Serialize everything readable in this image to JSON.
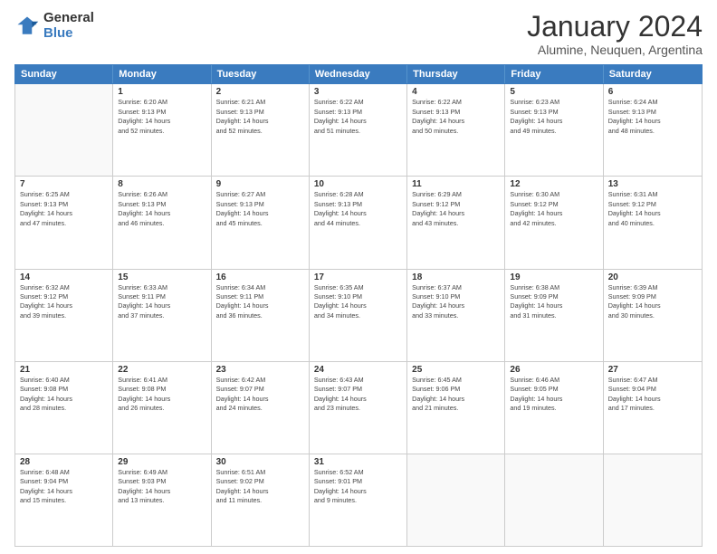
{
  "logo": {
    "text_general": "General",
    "text_blue": "Blue"
  },
  "title": "January 2024",
  "subtitle": "Alumine, Neuquen, Argentina",
  "header_days": [
    "Sunday",
    "Monday",
    "Tuesday",
    "Wednesday",
    "Thursday",
    "Friday",
    "Saturday"
  ],
  "weeks": [
    [
      {
        "day": "",
        "info": ""
      },
      {
        "day": "1",
        "info": "Sunrise: 6:20 AM\nSunset: 9:13 PM\nDaylight: 14 hours\nand 52 minutes."
      },
      {
        "day": "2",
        "info": "Sunrise: 6:21 AM\nSunset: 9:13 PM\nDaylight: 14 hours\nand 52 minutes."
      },
      {
        "day": "3",
        "info": "Sunrise: 6:22 AM\nSunset: 9:13 PM\nDaylight: 14 hours\nand 51 minutes."
      },
      {
        "day": "4",
        "info": "Sunrise: 6:22 AM\nSunset: 9:13 PM\nDaylight: 14 hours\nand 50 minutes."
      },
      {
        "day": "5",
        "info": "Sunrise: 6:23 AM\nSunset: 9:13 PM\nDaylight: 14 hours\nand 49 minutes."
      },
      {
        "day": "6",
        "info": "Sunrise: 6:24 AM\nSunset: 9:13 PM\nDaylight: 14 hours\nand 48 minutes."
      }
    ],
    [
      {
        "day": "7",
        "info": "Sunrise: 6:25 AM\nSunset: 9:13 PM\nDaylight: 14 hours\nand 47 minutes."
      },
      {
        "day": "8",
        "info": "Sunrise: 6:26 AM\nSunset: 9:13 PM\nDaylight: 14 hours\nand 46 minutes."
      },
      {
        "day": "9",
        "info": "Sunrise: 6:27 AM\nSunset: 9:13 PM\nDaylight: 14 hours\nand 45 minutes."
      },
      {
        "day": "10",
        "info": "Sunrise: 6:28 AM\nSunset: 9:13 PM\nDaylight: 14 hours\nand 44 minutes."
      },
      {
        "day": "11",
        "info": "Sunrise: 6:29 AM\nSunset: 9:12 PM\nDaylight: 14 hours\nand 43 minutes."
      },
      {
        "day": "12",
        "info": "Sunrise: 6:30 AM\nSunset: 9:12 PM\nDaylight: 14 hours\nand 42 minutes."
      },
      {
        "day": "13",
        "info": "Sunrise: 6:31 AM\nSunset: 9:12 PM\nDaylight: 14 hours\nand 40 minutes."
      }
    ],
    [
      {
        "day": "14",
        "info": "Sunrise: 6:32 AM\nSunset: 9:12 PM\nDaylight: 14 hours\nand 39 minutes."
      },
      {
        "day": "15",
        "info": "Sunrise: 6:33 AM\nSunset: 9:11 PM\nDaylight: 14 hours\nand 37 minutes."
      },
      {
        "day": "16",
        "info": "Sunrise: 6:34 AM\nSunset: 9:11 PM\nDaylight: 14 hours\nand 36 minutes."
      },
      {
        "day": "17",
        "info": "Sunrise: 6:35 AM\nSunset: 9:10 PM\nDaylight: 14 hours\nand 34 minutes."
      },
      {
        "day": "18",
        "info": "Sunrise: 6:37 AM\nSunset: 9:10 PM\nDaylight: 14 hours\nand 33 minutes."
      },
      {
        "day": "19",
        "info": "Sunrise: 6:38 AM\nSunset: 9:09 PM\nDaylight: 14 hours\nand 31 minutes."
      },
      {
        "day": "20",
        "info": "Sunrise: 6:39 AM\nSunset: 9:09 PM\nDaylight: 14 hours\nand 30 minutes."
      }
    ],
    [
      {
        "day": "21",
        "info": "Sunrise: 6:40 AM\nSunset: 9:08 PM\nDaylight: 14 hours\nand 28 minutes."
      },
      {
        "day": "22",
        "info": "Sunrise: 6:41 AM\nSunset: 9:08 PM\nDaylight: 14 hours\nand 26 minutes."
      },
      {
        "day": "23",
        "info": "Sunrise: 6:42 AM\nSunset: 9:07 PM\nDaylight: 14 hours\nand 24 minutes."
      },
      {
        "day": "24",
        "info": "Sunrise: 6:43 AM\nSunset: 9:07 PM\nDaylight: 14 hours\nand 23 minutes."
      },
      {
        "day": "25",
        "info": "Sunrise: 6:45 AM\nSunset: 9:06 PM\nDaylight: 14 hours\nand 21 minutes."
      },
      {
        "day": "26",
        "info": "Sunrise: 6:46 AM\nSunset: 9:05 PM\nDaylight: 14 hours\nand 19 minutes."
      },
      {
        "day": "27",
        "info": "Sunrise: 6:47 AM\nSunset: 9:04 PM\nDaylight: 14 hours\nand 17 minutes."
      }
    ],
    [
      {
        "day": "28",
        "info": "Sunrise: 6:48 AM\nSunset: 9:04 PM\nDaylight: 14 hours\nand 15 minutes."
      },
      {
        "day": "29",
        "info": "Sunrise: 6:49 AM\nSunset: 9:03 PM\nDaylight: 14 hours\nand 13 minutes."
      },
      {
        "day": "30",
        "info": "Sunrise: 6:51 AM\nSunset: 9:02 PM\nDaylight: 14 hours\nand 11 minutes."
      },
      {
        "day": "31",
        "info": "Sunrise: 6:52 AM\nSunset: 9:01 PM\nDaylight: 14 hours\nand 9 minutes."
      },
      {
        "day": "",
        "info": ""
      },
      {
        "day": "",
        "info": ""
      },
      {
        "day": "",
        "info": ""
      }
    ]
  ]
}
